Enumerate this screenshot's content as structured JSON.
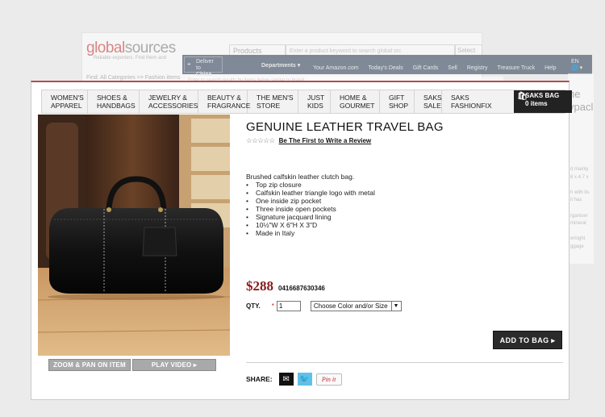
{
  "background_sites": {
    "global_sources": {
      "logo_a": "global",
      "logo_b": "sources",
      "tagline": "Reliable exporters. Find them and",
      "category_select": "Products",
      "search_placeholder": "Enter a product keyword to search global src",
      "search_button": "Select",
      "breadcrumb": "Find: All Categories >> Fashion items"
    },
    "amazon": {
      "deliver_line1": "Deliver to",
      "deliver_line2": "China",
      "departments": "Departments ▾",
      "links": [
        "Your Amazon.com",
        "Today's Deals",
        "Gift Cards",
        "Sell",
        "Registry",
        "Treasure Truck",
        "Help"
      ],
      "lang": "EN",
      "lang_sub": "🌐 ▾"
    },
    "faint_search": "Enter to search results by items below similar to brand",
    "right_partial": {
      "lines": [
        "ne",
        "ypacl"
      ],
      "small_lines": [
        "d mainly",
        "6 x 4.7 x",
        "",
        "h with its",
        "it has",
        "",
        "rganiser",
        "mineral",
        "",
        "ernight",
        "ggage"
      ]
    }
  },
  "nav": {
    "items": [
      {
        "label1": "WOMEN'S",
        "label2": "APPAREL",
        "width": 57
      },
      {
        "label1": "SHOES &",
        "label2": "HANDBAGS",
        "width": 64
      },
      {
        "label1": "JEWELRY &",
        "label2": "ACCESSORIES",
        "width": 73
      },
      {
        "label1": "BEAUTY &",
        "label2": "FRAGRANCE",
        "width": 61
      },
      {
        "label1": "THE MEN'S",
        "label2": "STORE",
        "width": 63
      },
      {
        "label1": "JUST",
        "label2": "KIDS",
        "width": 40
      },
      {
        "label1": "HOME &",
        "label2": "GOURMET",
        "width": 61
      },
      {
        "label1": "GIFT",
        "label2": "SHOP",
        "width": 43
      },
      {
        "label1": "SAKS",
        "label2": "SALE",
        "width": 34
      },
      {
        "label1": "SAKS",
        "label2": "FASHIONFIX",
        "width": 70
      }
    ],
    "bag_label": "SAKS BAG",
    "bag_count": "0 items",
    "bag_icon": "shopping-bag-icon"
  },
  "product": {
    "title": "GENUINE LEATHER TRAVEL BAG",
    "stars": "☆☆☆☆☆",
    "review_link": "Be The First to Write a Review",
    "description_heading": "Brushed calfskin leather clutch bag.",
    "features": [
      "Top zip closure",
      "Calfskin leather triangle logo with metal",
      "One inside zip pocket",
      "Three inside open pockets",
      "Signature jacquard lining",
      "10½\"W X 6\"H X 3\"D",
      "Made in Italy"
    ],
    "price": "$288",
    "sku": "0416687630346",
    "qty_label": "QTY.",
    "qty_required": "*",
    "qty_value": "1",
    "color_select": "Choose Color and/or Size",
    "add_to_bag": "ADD TO BAG ▸",
    "share_label": "SHARE:",
    "pin_label": "Pin it"
  },
  "image_buttons": {
    "zoom": "ZOOM & PAN ON ITEM",
    "video": "PLAY VIDEO"
  },
  "colors": {
    "price": "#8b1a1a",
    "accent_border": "#b24c50",
    "bag_button": "#2b2b2b",
    "twitter": "#5fc0ea",
    "pinterest": "#c8232c"
  }
}
